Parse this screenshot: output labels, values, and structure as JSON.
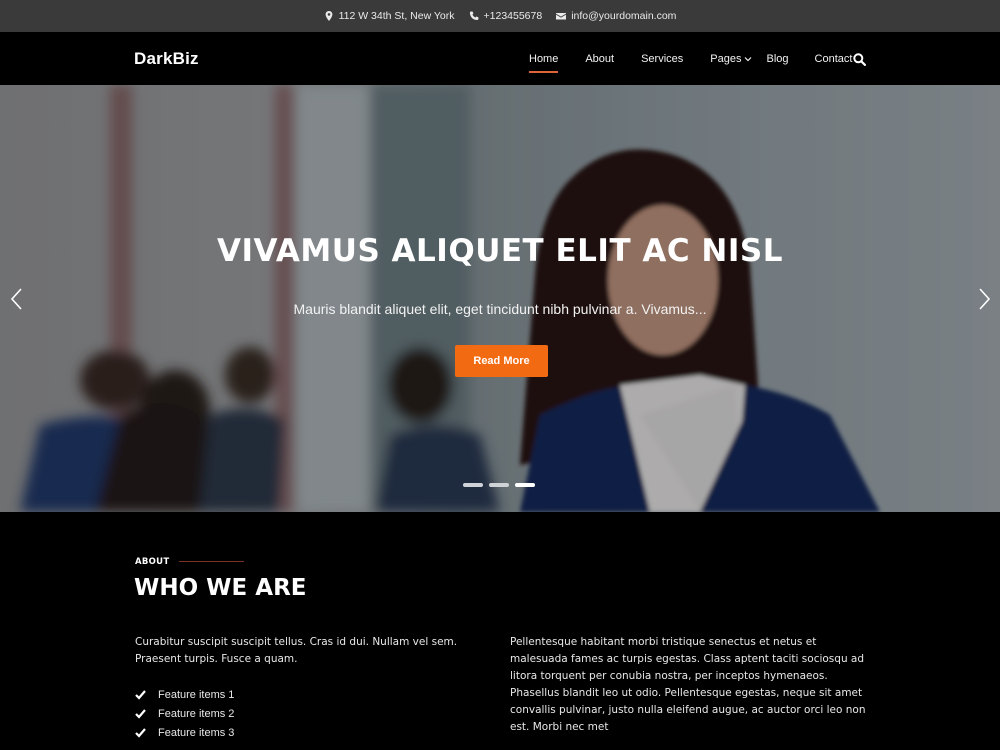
{
  "topbar": {
    "address": {
      "icon": "map-marker-icon",
      "text": "112 W 34th St, New York"
    },
    "phone": {
      "icon": "phone-icon",
      "text": "+123455678"
    },
    "email": {
      "icon": "envelope-icon",
      "text": "info@yourdomain.com"
    }
  },
  "header": {
    "logo": "DarkBiz",
    "nav": [
      {
        "label": "Home",
        "active": true
      },
      {
        "label": "About"
      },
      {
        "label": "Services"
      },
      {
        "label": "Pages",
        "has_dropdown": true
      },
      {
        "label": "Blog"
      },
      {
        "label": "Contact"
      }
    ],
    "search_icon": "search-icon"
  },
  "hero": {
    "title": "VIVAMUS ALIQUET ELIT AC NISL",
    "subtitle": "Mauris blandit aliquet elit, eget tincidunt nibh pulvinar a. Vivamus...",
    "button_label": "Read More",
    "slide_count": 3,
    "active_slide": 3,
    "prev_icon": "chevron-left-icon",
    "next_icon": "chevron-right-icon"
  },
  "about": {
    "label": "ABOUT",
    "title": "WHO WE ARE",
    "left_text": "Curabitur suscipit suscipit tellus. Cras id dui. Nullam vel sem. Praesent turpis. Fusce a quam.",
    "features": [
      "Feature items 1",
      "Feature items 2",
      "Feature items 3"
    ],
    "right_text": "Pellentesque habitant morbi tristique senectus et netus et malesuada fames ac turpis egestas. Class aptent taciti sociosqu ad litora torquent per conubia nostra, per inceptos hymenaeos. Phasellus blandit leo ut odio. Pellentesque egestas, neque sit amet convallis pulvinar, justo nulla eleifend augue, ac auctor orci leo non est. Morbi nec met"
  },
  "colors": {
    "accent": "#f26b12",
    "nav_underline": "#e0643a",
    "topbar_bg": "#3a3a3a",
    "page_bg": "#000000"
  }
}
